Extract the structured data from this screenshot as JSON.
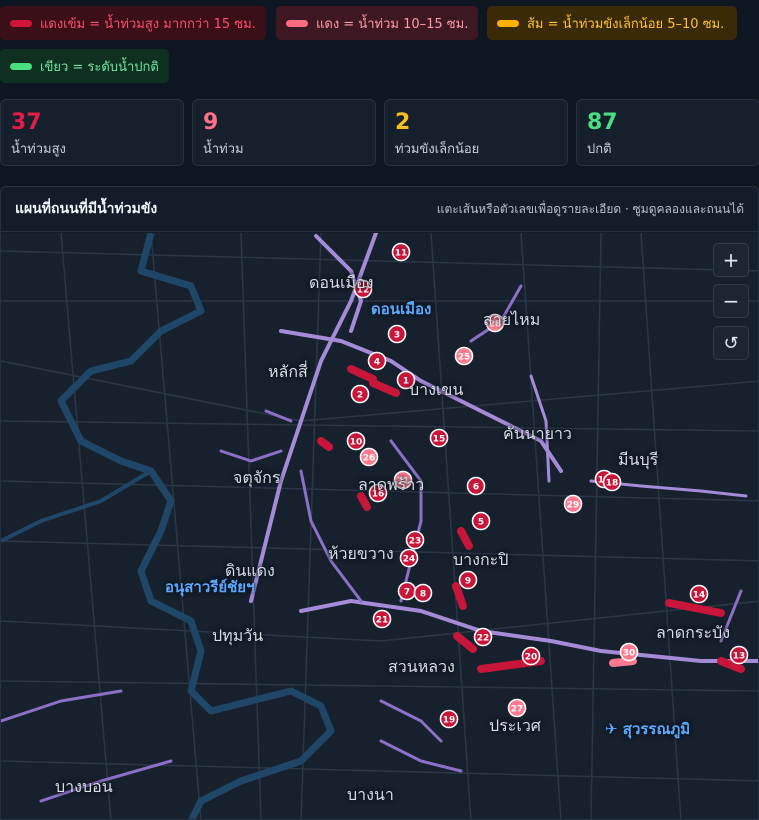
{
  "legend": [
    {
      "id": "dark",
      "label": "แดงเข้ม = น้ำท่วมสูง มากกว่า 15 ซม.",
      "color": "#d0143a"
    },
    {
      "id": "red",
      "label": "แดง = น้ำท่วม 10–15 ซม.",
      "color": "#ff6b81"
    },
    {
      "id": "orange",
      "label": "ส้ม = น้ำท่วมขังเล็กน้อย 5–10 ซม.",
      "color": "#ffb000"
    },
    {
      "id": "green",
      "label": "เขียว = ระดับน้ำปกติ",
      "color": "#4ade80"
    }
  ],
  "stats": [
    {
      "value": "37",
      "label": "น้ำท่วมสูง"
    },
    {
      "value": "9",
      "label": "น้ำท่วม"
    },
    {
      "value": "2",
      "label": "ท่วมขังเล็กน้อย"
    },
    {
      "value": "87",
      "label": "ปกติ"
    }
  ],
  "panel": {
    "title": "แผนที่ถนนที่มีน้ำท่วมขัง",
    "hint": "แตะเส้นหรือตัวเลขเพื่อดูรายละเอียด · ซูมดูคลองและถนนได้"
  },
  "controls": {
    "zoom_in": "+",
    "zoom_out": "−",
    "reset": "↺"
  },
  "places": [
    {
      "name": "ดอนเมือง",
      "kind": "district"
    },
    {
      "name": "ดอนเมือง",
      "kind": "highlight"
    },
    {
      "name": "สายไหม",
      "kind": "district"
    },
    {
      "name": "หลักสี่",
      "kind": "district"
    },
    {
      "name": "บางเขน",
      "kind": "district"
    },
    {
      "name": "คันนายาว",
      "kind": "district"
    },
    {
      "name": "มีนบุรี",
      "kind": "district"
    },
    {
      "name": "จตุจักร",
      "kind": "district"
    },
    {
      "name": "ลาดพร้าว",
      "kind": "district"
    },
    {
      "name": "ห้วยขวาง",
      "kind": "district"
    },
    {
      "name": "บางกะปิ",
      "kind": "district"
    },
    {
      "name": "ดินแดง",
      "kind": "district"
    },
    {
      "name": "อนุสาวรีย์ชัยฯ",
      "kind": "highlight"
    },
    {
      "name": "ปทุมวัน",
      "kind": "district"
    },
    {
      "name": "ลาดกระบัง",
      "kind": "district"
    },
    {
      "name": "สวนหลวง",
      "kind": "district"
    },
    {
      "name": "ประเวศ",
      "kind": "district"
    },
    {
      "name": "✈ สุวรรณภูมิ",
      "kind": "highlight"
    },
    {
      "name": "บางบอน",
      "kind": "district"
    },
    {
      "name": "บางนา",
      "kind": "district"
    }
  ],
  "markers": [
    {
      "n": "1",
      "level": "dark"
    },
    {
      "n": "2",
      "level": "dark"
    },
    {
      "n": "3",
      "level": "dark"
    },
    {
      "n": "4",
      "level": "dark"
    },
    {
      "n": "5",
      "level": "dark"
    },
    {
      "n": "6",
      "level": "dark"
    },
    {
      "n": "7",
      "level": "dark"
    },
    {
      "n": "8",
      "level": "dark"
    },
    {
      "n": "9",
      "level": "dark"
    },
    {
      "n": "10",
      "level": "dark"
    },
    {
      "n": "11",
      "level": "dark"
    },
    {
      "n": "12",
      "level": "dark"
    },
    {
      "n": "13",
      "level": "dark"
    },
    {
      "n": "14",
      "level": "dark"
    },
    {
      "n": "15",
      "level": "dark"
    },
    {
      "n": "16",
      "level": "dark"
    },
    {
      "n": "17",
      "level": "dark"
    },
    {
      "n": "18",
      "level": "dark"
    },
    {
      "n": "19",
      "level": "dark"
    },
    {
      "n": "20",
      "level": "dark"
    },
    {
      "n": "21",
      "level": "dark"
    },
    {
      "n": "22",
      "level": "dark"
    },
    {
      "n": "23",
      "level": "dark"
    },
    {
      "n": "24",
      "level": "dark"
    },
    {
      "n": "25",
      "level": "red"
    },
    {
      "n": "26",
      "level": "red"
    },
    {
      "n": "27",
      "level": "red"
    },
    {
      "n": "28",
      "level": "red"
    },
    {
      "n": "29",
      "level": "red"
    },
    {
      "n": "30",
      "level": "red"
    },
    {
      "n": "31",
      "level": "red"
    }
  ]
}
